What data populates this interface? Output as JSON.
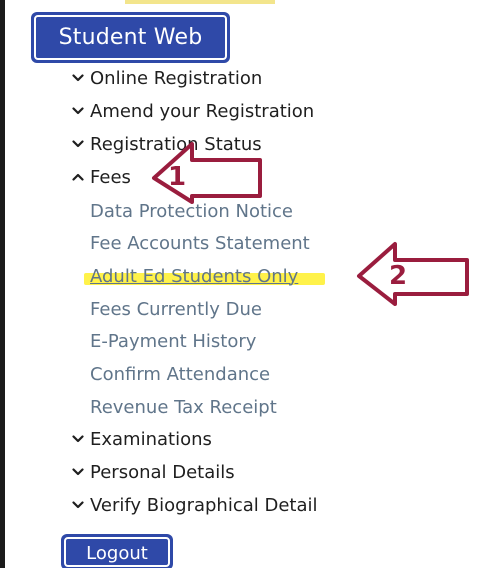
{
  "header": {
    "title": "Student Web"
  },
  "menu": {
    "items": [
      {
        "label": "Online Registration",
        "icon": "chevron-down-icon"
      },
      {
        "label": "Amend your Registration",
        "icon": "chevron-down-icon"
      },
      {
        "label": "Registration Status",
        "icon": "chevron-down-icon"
      },
      {
        "label": "Fees",
        "icon": "chevron-up-icon",
        "expanded": true
      },
      {
        "label": "Examinations",
        "icon": "chevron-down-icon"
      },
      {
        "label": "Personal Details",
        "icon": "chevron-down-icon"
      },
      {
        "label": "Verify Biographical Detail",
        "icon": "chevron-down-icon"
      }
    ],
    "fees_subitems": [
      {
        "label": "Data Protection Notice"
      },
      {
        "label": "Fee Accounts Statement"
      },
      {
        "label": "Adult Ed Students Only",
        "highlighted": true
      },
      {
        "label": "Fees Currently Due"
      },
      {
        "label": "E-Payment History"
      },
      {
        "label": "Confirm Attendance"
      },
      {
        "label": "Revenue Tax Receipt"
      }
    ]
  },
  "footer": {
    "logout_label": "Logout"
  },
  "annotations": {
    "callout_1": "1",
    "callout_2": "2",
    "arrow_color": "#9a1d3e",
    "highlight_color": "#fff24a"
  },
  "colors": {
    "button_bg": "#2f49a8",
    "menu_text": "#1f1f1f",
    "submenu_text": "#60758a"
  }
}
